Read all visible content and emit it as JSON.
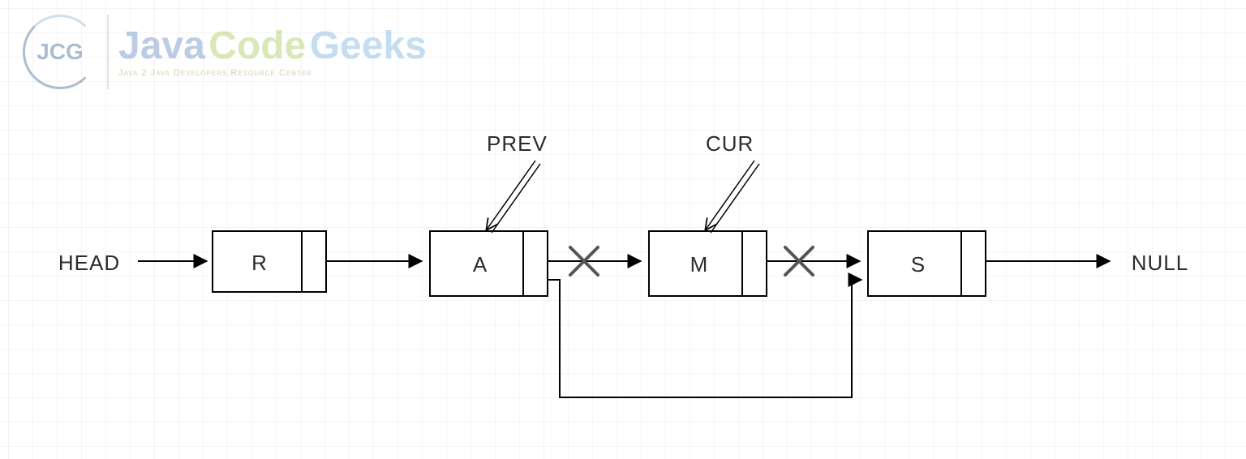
{
  "logo": {
    "badge": "JCG",
    "word1": "Java",
    "word2": "Code",
    "word3": "Geeks",
    "tagline": "Java 2 Java Developers Resource Center"
  },
  "labels": {
    "head": "HEAD",
    "null": "NULL",
    "prev": "PREV",
    "cur": "CUR"
  },
  "nodes": {
    "n1": "R",
    "n2": "A",
    "n3": "M",
    "n4": "S"
  }
}
